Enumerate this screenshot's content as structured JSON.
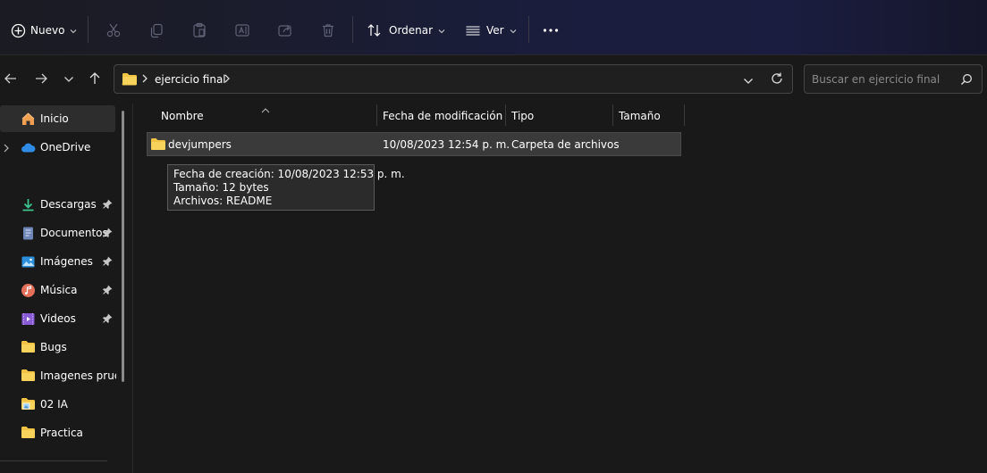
{
  "toolbar": {
    "new_label": "Nuevo",
    "sort_label": "Ordenar",
    "view_label": "Ver",
    "icons": [
      "add-icon",
      "cut-icon",
      "copy-icon",
      "paste-icon",
      "rename-icon",
      "share-icon",
      "delete-icon",
      "sort-icon",
      "view-icon",
      "more-icon"
    ]
  },
  "address": {
    "path": "ejercicio final",
    "search_placeholder": "Buscar en ejercicio final"
  },
  "sidebar": {
    "items": [
      {
        "label": "Inicio",
        "icon": "home-icon",
        "selected": true
      },
      {
        "label": "OneDrive",
        "icon": "cloud-icon"
      },
      {
        "label": "Descargas",
        "icon": "download-icon",
        "pinned": true
      },
      {
        "label": "Documentos",
        "icon": "document-icon",
        "pinned": true
      },
      {
        "label": "Imágenes",
        "icon": "pictures-icon",
        "pinned": true
      },
      {
        "label": "Música",
        "icon": "music-icon",
        "pinned": true
      },
      {
        "label": "Videos",
        "icon": "videos-icon",
        "pinned": true
      },
      {
        "label": "Bugs",
        "icon": "folder-icon"
      },
      {
        "label": "Imagenes prueb",
        "icon": "folder-icon"
      },
      {
        "label": "02 IA",
        "icon": "folder-image-icon"
      },
      {
        "label": "Practica",
        "icon": "folder-icon"
      }
    ]
  },
  "table": {
    "columns": [
      "Nombre",
      "Fecha de modificación",
      "Tipo",
      "Tamaño"
    ],
    "rows": [
      {
        "name": "devjumpers",
        "modified": "10/08/2023 12:54 p. m.",
        "type": "Carpeta de archivos",
        "size": ""
      }
    ]
  },
  "tooltip": {
    "created": "Fecha de creación: 10/08/2023 12:53 p. m.",
    "size": "Tamaño: 12 bytes",
    "files": "Archivos: README"
  },
  "colors": {
    "folder": "#f5c542",
    "selection": "#3a3a3a",
    "background": "#191919"
  }
}
